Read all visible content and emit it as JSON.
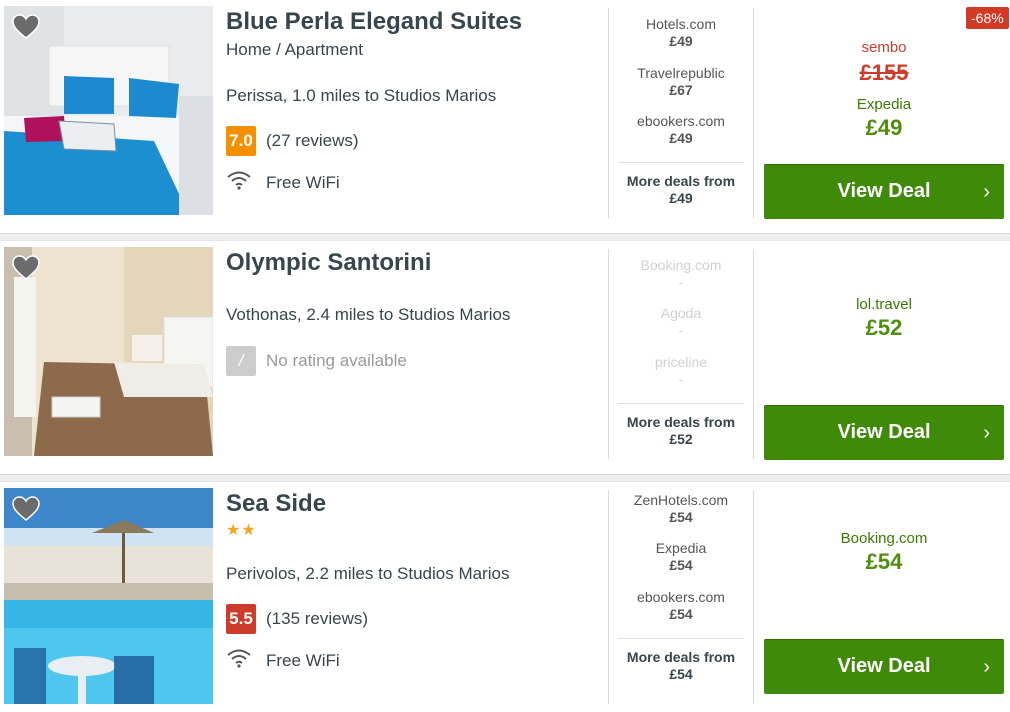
{
  "hotels": [
    {
      "name": "Blue Perla Elegand Suites",
      "type": "Home / Apartment",
      "location": "Perissa, 1.0 miles to Studios Marios",
      "score": "7.0",
      "reviews": "(27 reviews)",
      "amenity": "Free WiFi",
      "deals": [
        {
          "provider": "Hotels.com",
          "price": "£49"
        },
        {
          "provider": "Travelrepublic",
          "price": "£67"
        },
        {
          "provider": "ebookers.com",
          "price": "£49"
        }
      ],
      "more_label": "More deals from",
      "more_price": "£49",
      "main_provider_old": "sembo",
      "old_price": "£155",
      "main_provider": "Expedia",
      "main_price": "£49",
      "discount": "-68%",
      "button": "View Deal"
    },
    {
      "name": "Olympic Santorini",
      "location": "Vothonas, 2.4 miles to Studios Marios",
      "score": "/",
      "reviews": "No rating available",
      "deals": [
        {
          "provider": "Booking.com",
          "price": "-"
        },
        {
          "provider": "Agoda",
          "price": "-"
        },
        {
          "provider": "priceline",
          "price": "-"
        }
      ],
      "more_label": "More deals from",
      "more_price": "£52",
      "main_provider": "lol.travel",
      "main_price": "£52",
      "button": "View Deal"
    },
    {
      "name": "Sea Side",
      "stars": "★★",
      "location": "Perivolos, 2.2 miles to Studios Marios",
      "score": "5.5",
      "reviews": "(135 reviews)",
      "amenity": "Free WiFi",
      "deals": [
        {
          "provider": "ZenHotels.com",
          "price": "£54"
        },
        {
          "provider": "Expedia",
          "price": "£54"
        },
        {
          "provider": "ebookers.com",
          "price": "£54"
        }
      ],
      "more_label": "More deals from",
      "more_price": "£54",
      "main_provider": "Booking.com",
      "main_price": "£54",
      "button": "View Deal"
    }
  ],
  "icons": {
    "favorite": "heart-icon",
    "wifi": "wifi-icon",
    "chevron": "chevron-right-icon"
  },
  "colors": {
    "deal_button": "#3f8a08",
    "score_good": "#f48f00",
    "score_avg": "#cd3b2b",
    "price_green": "#4d8f0c",
    "discount_badge": "#d23a25"
  }
}
